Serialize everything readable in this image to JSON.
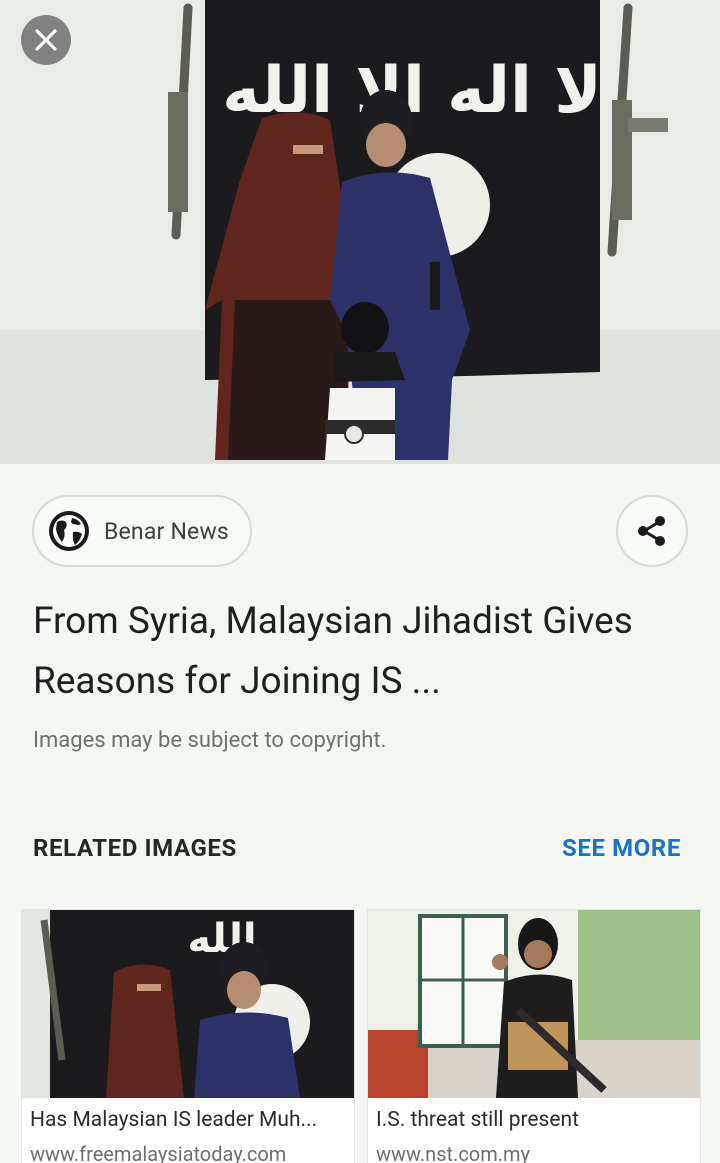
{
  "hero": {
    "image_name": "jihadist-family-photo",
    "flag_text": "لا اله الا الله"
  },
  "source": {
    "name": "Benar News",
    "icon": "globe-icon"
  },
  "share": {
    "icon": "share-icon"
  },
  "close": {
    "icon": "close-icon"
  },
  "title": "From Syria, Malaysian Jihadist Gives Reasons for Joining IS ...",
  "copyright_note": "Images may be subject to copyright.",
  "related": {
    "heading": "RELATED IMAGES",
    "see_more": "SEE MORE",
    "items": [
      {
        "caption": "Has Malaysian IS leader Muh...",
        "domain": "www.freemalaysiatoday.com",
        "flag_text": "الله"
      },
      {
        "caption": "I.S. threat still present",
        "domain": "www.nst.com.my"
      }
    ]
  },
  "colors": {
    "accent": "#1a73c8",
    "background": "#f4f7f3",
    "flag": "#1b1b1d"
  }
}
